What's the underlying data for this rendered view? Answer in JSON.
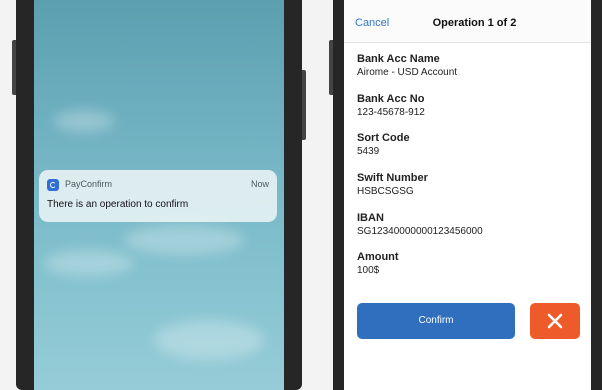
{
  "notification": {
    "app_name": "PayConfirm",
    "time": "Now",
    "message": "There is an operation to confirm"
  },
  "operation": {
    "cancel_label": "Cancel",
    "title": "Operation 1 of 2",
    "fields": [
      {
        "label": "Bank Acc Name",
        "value": "Airome - USD Account"
      },
      {
        "label": "Bank Acc No",
        "value": "123-45678-912"
      },
      {
        "label": "Sort Code",
        "value": "5439"
      },
      {
        "label": "Swift Number",
        "value": "HSBCSGSG"
      },
      {
        "label": "IBAN",
        "value": "SG12340000000123456000"
      },
      {
        "label": "Amount",
        "value": "100$"
      }
    ],
    "confirm_label": "Confirm",
    "reject_icon": "close-icon"
  },
  "colors": {
    "accent_blue": "#2f6fbe",
    "reject_orange": "#ee5a2a",
    "link_blue": "#2f78c8"
  }
}
